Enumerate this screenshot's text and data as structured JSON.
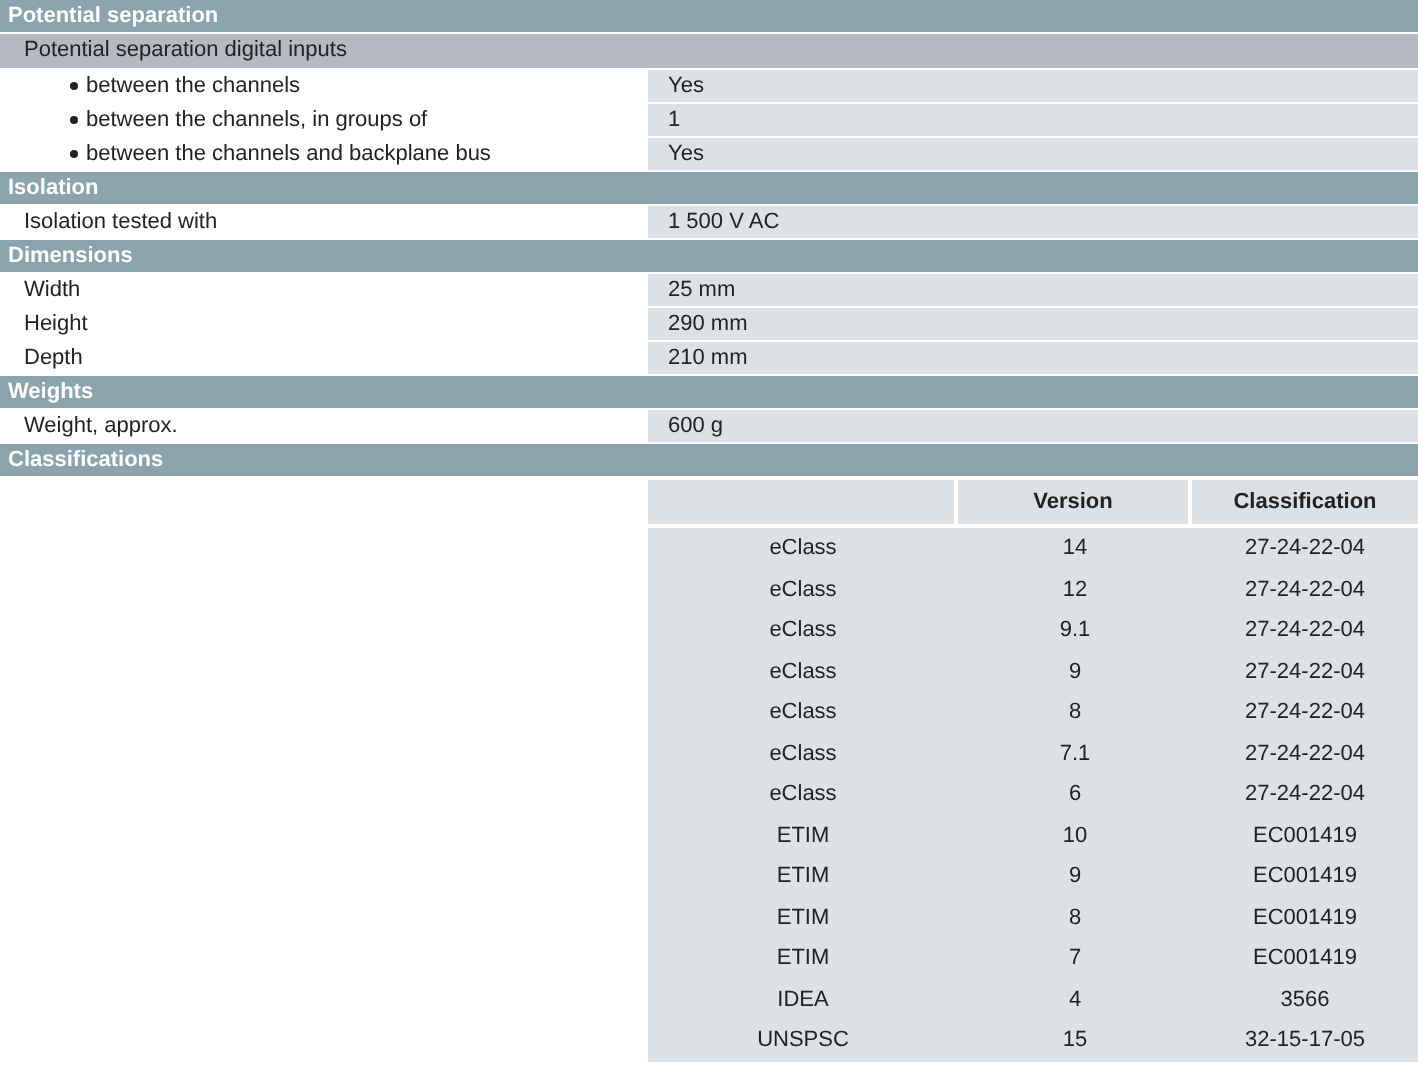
{
  "sections": [
    {
      "title": "Potential separation",
      "rows": [
        {
          "kind": "subheader",
          "label": "Potential separation digital inputs"
        },
        {
          "kind": "bullet",
          "label": "between the channels",
          "value": "Yes"
        },
        {
          "kind": "bullet",
          "label": "between the channels, in groups of",
          "value": "1"
        },
        {
          "kind": "bullet",
          "label": "between the channels and backplane bus",
          "value": "Yes"
        }
      ]
    },
    {
      "title": "Isolation",
      "rows": [
        {
          "kind": "plain",
          "label": "Isolation tested with",
          "value": "1 500 V AC"
        }
      ]
    },
    {
      "title": "Dimensions",
      "rows": [
        {
          "kind": "plain",
          "label": "Width",
          "value": "25 mm"
        },
        {
          "kind": "plain",
          "label": "Height",
          "value": "290 mm"
        },
        {
          "kind": "plain",
          "label": "Depth",
          "value": "210 mm"
        }
      ]
    },
    {
      "title": "Weights",
      "rows": [
        {
          "kind": "plain",
          "label": "Weight, approx.",
          "value": "600 g"
        }
      ]
    },
    {
      "title": "Classifications"
    }
  ],
  "classifications": {
    "columns": [
      "",
      "Version",
      "Classification"
    ],
    "rows": [
      [
        "eClass",
        "14",
        "27-24-22-04"
      ],
      [
        "eClass",
        "12",
        "27-24-22-04"
      ],
      [
        "eClass",
        "9.1",
        "27-24-22-04"
      ],
      [
        "eClass",
        "9",
        "27-24-22-04"
      ],
      [
        "eClass",
        "8",
        "27-24-22-04"
      ],
      [
        "eClass",
        "7.1",
        "27-24-22-04"
      ],
      [
        "eClass",
        "6",
        "27-24-22-04"
      ],
      [
        "ETIM",
        "10",
        "EC001419"
      ],
      [
        "ETIM",
        "9",
        "EC001419"
      ],
      [
        "ETIM",
        "8",
        "EC001419"
      ],
      [
        "ETIM",
        "7",
        "EC001419"
      ],
      [
        "IDEA",
        "4",
        "3566"
      ],
      [
        "UNSPSC",
        "15",
        "32-15-17-05"
      ]
    ]
  }
}
